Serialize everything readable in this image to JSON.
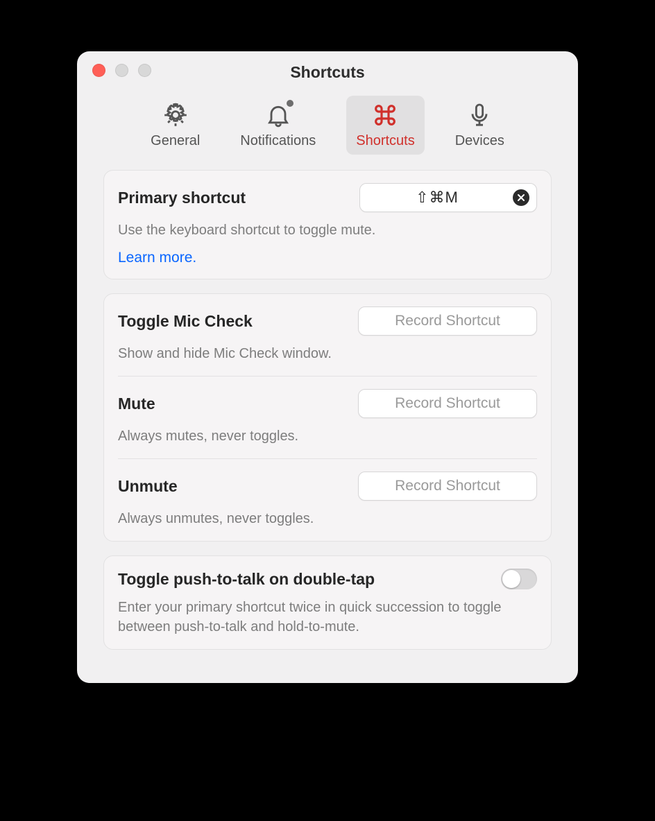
{
  "window": {
    "title": "Shortcuts"
  },
  "tabs": {
    "general": "General",
    "notifications": "Notifications",
    "shortcuts": "Shortcuts",
    "devices": "Devices"
  },
  "primary": {
    "title": "Primary shortcut",
    "value": "⇧⌘M",
    "desc": "Use the keyboard shortcut to toggle mute.",
    "learn": "Learn more."
  },
  "group": {
    "toggle_mic": {
      "title": "Toggle Mic Check",
      "desc": "Show and hide Mic Check window.",
      "button": "Record Shortcut"
    },
    "mute": {
      "title": "Mute",
      "desc": "Always mutes, never toggles.",
      "button": "Record Shortcut"
    },
    "unmute": {
      "title": "Unmute",
      "desc": "Always unmutes, never toggles.",
      "button": "Record Shortcut"
    }
  },
  "ptt": {
    "title": "Toggle push-to-talk on double-tap",
    "desc": "Enter your primary shortcut twice in quick succession to toggle between push-to-talk and hold-to-mute."
  }
}
